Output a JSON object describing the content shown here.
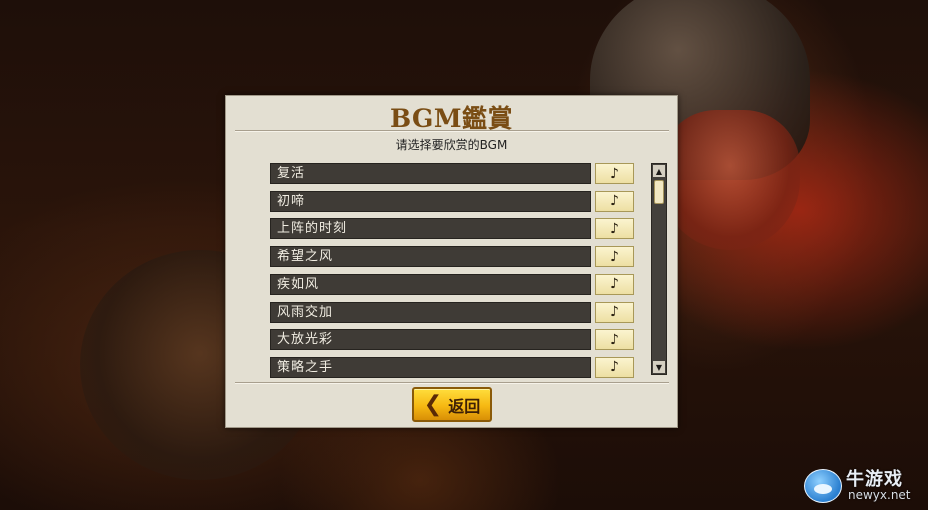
{
  "dialog": {
    "title": "BGM鑑賞",
    "subtitle": "请选择要欣赏的BGM"
  },
  "tracks": [
    {
      "name": "复活",
      "play_icon": "♪"
    },
    {
      "name": "初啼",
      "play_icon": "♪"
    },
    {
      "name": "上阵的时刻",
      "play_icon": "♪"
    },
    {
      "name": "希望之风",
      "play_icon": "♪"
    },
    {
      "name": "疾如风",
      "play_icon": "♪"
    },
    {
      "name": "风雨交加",
      "play_icon": "♪"
    },
    {
      "name": "大放光彩",
      "play_icon": "♪"
    },
    {
      "name": "策略之手",
      "play_icon": "♪"
    }
  ],
  "scrollbar": {
    "up_icon": "▲",
    "down_icon": "▼",
    "position": 0.0
  },
  "back_button": {
    "arrow_icon": "❮",
    "label": "返回"
  },
  "watermark": {
    "site_name": "牛游戏",
    "url": "newyx.net"
  },
  "colors": {
    "title": "#7a4d14",
    "panel_bg": "#e3dfd2",
    "row_bg": "#3f3b36",
    "play_button": "#f3e8b8",
    "back_button": "#f6b812"
  }
}
